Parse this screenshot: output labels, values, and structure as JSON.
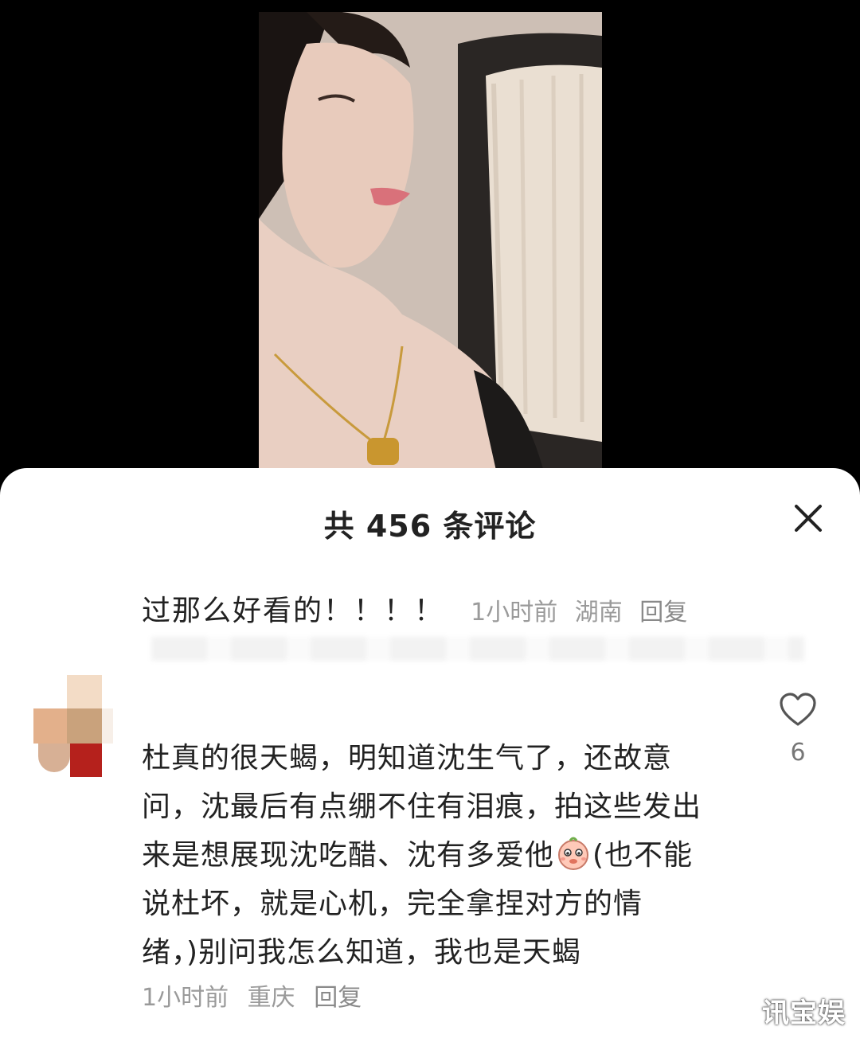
{
  "header": {
    "title": "共 456 条评论"
  },
  "partial_comment": {
    "text": "过那么好看的！！！！",
    "time": "1小时前",
    "location": "湖南",
    "reply_label": "回复"
  },
  "comment": {
    "lines": [
      "杜真的很天蝎，明知道沈生气了，还故意",
      "问，沈最后有点绷不住有泪痕，拍这些发出",
      "来是想展现沈吃醋、沈有多爱他",
      "(也不能",
      "说杜坏，就是心机，完全拿捏对方的情",
      "绪，)别问我怎么知道，我也是天蝎"
    ],
    "time": "1小时前",
    "location": "重庆",
    "reply_label": "回复",
    "like_count": "6",
    "emoji_icon": "blushing-face-emoji"
  },
  "watermark": "讯宝娱",
  "colors": {
    "sheet_bg": "#ffffff",
    "primary_text": "#222222",
    "meta_text": "#9a9a9a",
    "backdrop": "#000000"
  }
}
